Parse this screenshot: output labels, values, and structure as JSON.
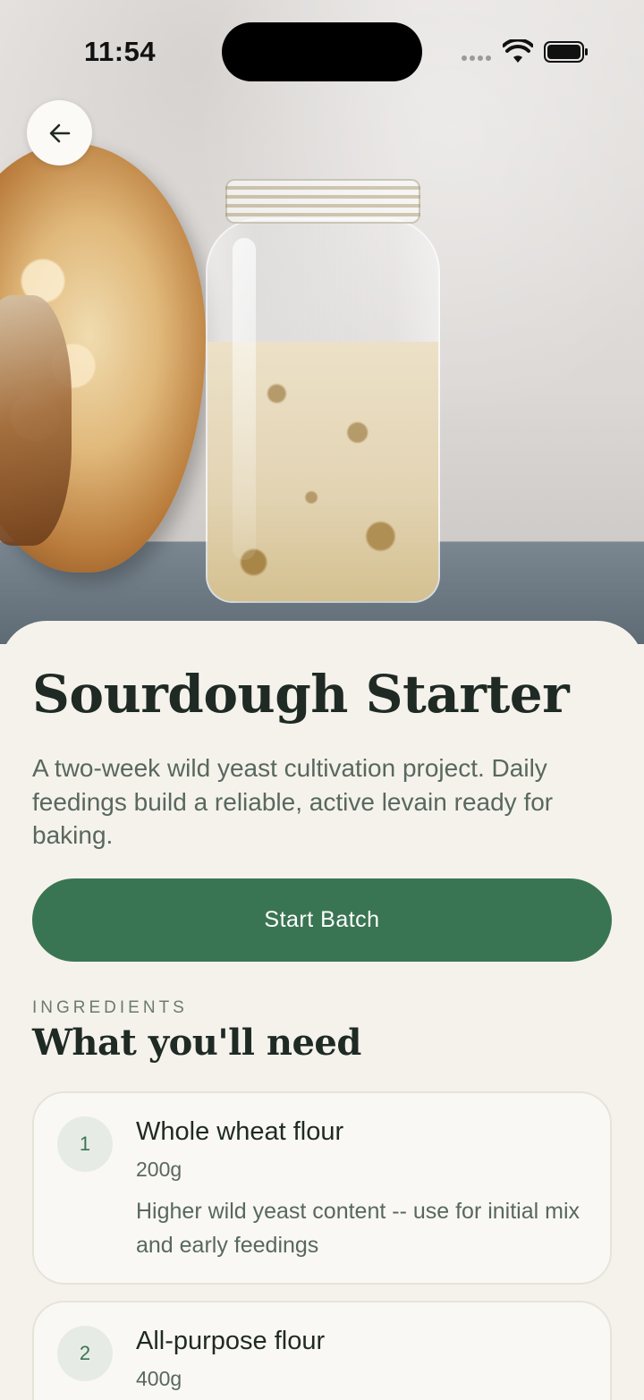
{
  "status_bar": {
    "time": "11:54",
    "icons": [
      "signal-icon",
      "wifi-icon",
      "battery-icon"
    ]
  },
  "hero": {
    "image": "sourdough-bread-and-starter-jar-photo",
    "back_icon": "arrow-left-icon"
  },
  "recipe": {
    "title": "Sourdough Starter",
    "description": "A two-week wild yeast cultivation project. Daily feedings build a reliable, active levain ready for baking.",
    "start_button_label": "Start Batch"
  },
  "ingredients": {
    "eyebrow": "INGREDIENTS",
    "title": "What you'll need",
    "items": [
      {
        "number": "1",
        "name": "Whole wheat flour",
        "quantity": "200g",
        "note": "Higher wild yeast content -- use for initial mix and early feedings"
      },
      {
        "number": "2",
        "name": "All-purpose flour",
        "quantity": "400g"
      }
    ]
  },
  "colors": {
    "accent_green": "#3a7553",
    "sheet_background": "#f5f2ec",
    "title_text": "#1f2a24",
    "muted_text": "#58685e"
  }
}
